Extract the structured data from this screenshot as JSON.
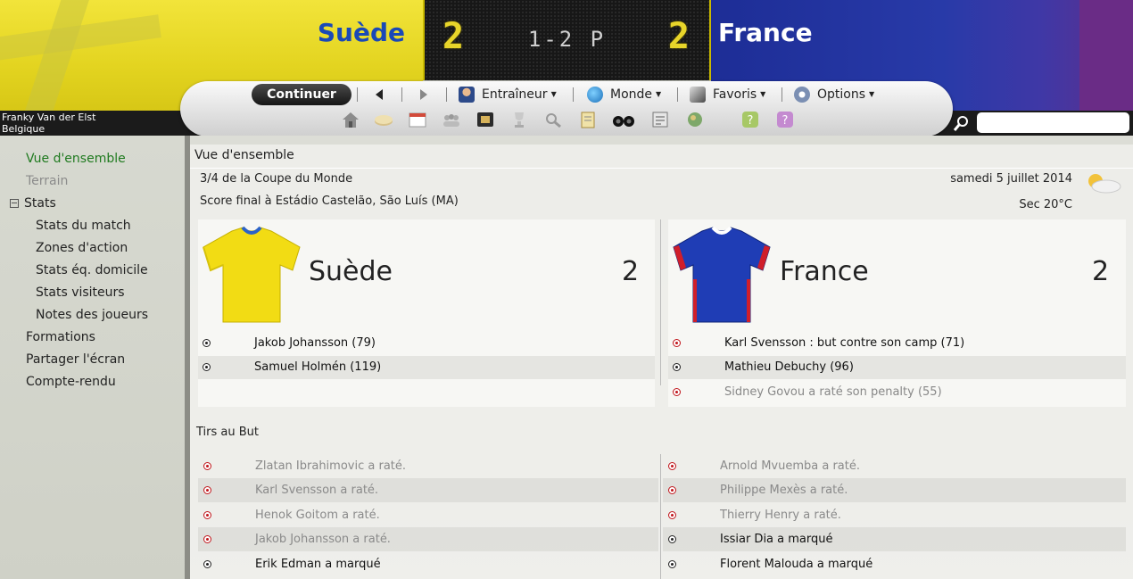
{
  "header": {
    "home_team": "Suède",
    "away_team": "France",
    "home_score": "2",
    "away_score": "2",
    "penalties": "1-2 P"
  },
  "manager": {
    "name": "Franky Van der Elst",
    "nation": "Belgique"
  },
  "toolbar": {
    "continue_label": "Continuer",
    "menus": [
      {
        "label": "Entraîneur"
      },
      {
        "label": "Monde"
      },
      {
        "label": "Favoris"
      },
      {
        "label": "Options"
      }
    ],
    "icons": [
      "home-icon",
      "inbox-icon",
      "calendar-icon",
      "squad-icon",
      "tactics-icon",
      "trophy-icon",
      "scouting-icon",
      "clipboard-icon",
      "binoculars-icon",
      "report-icon",
      "world-icon",
      "help-icon",
      "question-icon"
    ]
  },
  "search": {
    "placeholder": ""
  },
  "nav": {
    "items": [
      {
        "label": "Vue d'ensemble"
      },
      {
        "label": "Terrain"
      },
      {
        "label": "Stats"
      },
      {
        "label": "Stats du match"
      },
      {
        "label": "Zones d'action"
      },
      {
        "label": "Stats éq. domicile"
      },
      {
        "label": "Stats visiteurs"
      },
      {
        "label": "Notes des joueurs"
      },
      {
        "label": "Formations"
      },
      {
        "label": "Partager l'écran"
      },
      {
        "label": "Compte-rendu"
      }
    ]
  },
  "overview": {
    "title": "Vue d'ensemble",
    "competition": "3/4 de la Coupe du Monde",
    "venue": "Score final à Estádio Castelão, São Luís (MA)",
    "date": "samedi 5 juillet 2014",
    "weather": "Sec 20°C"
  },
  "home": {
    "name": "Suède",
    "score": "2",
    "events": [
      "Jakob Johansson (79)",
      "Samuel Holmén (119)"
    ]
  },
  "away": {
    "name": "France",
    "score": "2",
    "events": [
      "Karl Svensson : but contre son camp (71)",
      "Mathieu Debuchy (96)",
      "Sidney Govou a raté son penalty (55)"
    ]
  },
  "shootout": {
    "title": "Tirs au But",
    "home": [
      "Zlatan Ibrahimovic a raté.",
      "Karl Svensson a raté.",
      "Henok Goitom a raté.",
      "Jakob Johansson a raté.",
      "Erik Edman a marqué"
    ],
    "away": [
      "Arnold Mvuemba a raté.",
      "Philippe Mexès a raté.",
      "Thierry Henry a raté.",
      "Issiar Dia a marqué",
      "Florent Malouda a marqué"
    ]
  },
  "colors": {
    "home_shirt": "#f2dc14",
    "away_shirt": "#1f3db5",
    "active_nav": "#1f7a1f"
  }
}
